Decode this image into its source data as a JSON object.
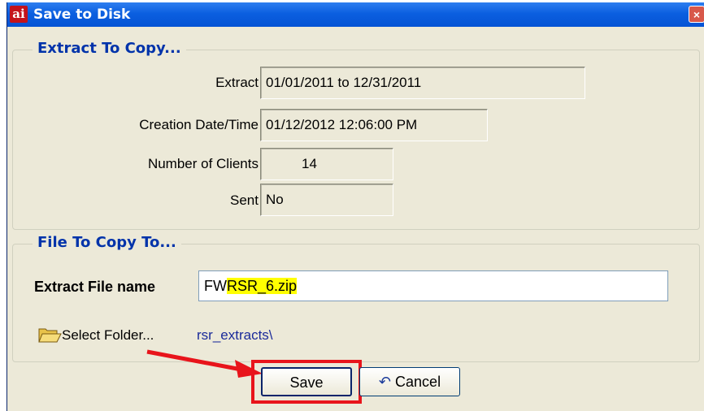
{
  "window": {
    "title": "Save to Disk",
    "app_icon": "ai",
    "close_glyph": "×"
  },
  "extract_group": {
    "legend": "Extract To Copy...",
    "fields": [
      {
        "label": "Extract",
        "value": "01/01/2011 to 12/31/2011"
      },
      {
        "label": "Creation Date/Time",
        "value": "01/12/2012 12:06:00 PM"
      },
      {
        "label": "Number of Clients",
        "value": "14"
      },
      {
        "label": "Sent",
        "value": "No"
      }
    ]
  },
  "file_group": {
    "legend": "File To Copy To...",
    "file_label": "Extract File name",
    "file_value_prefix": "FW",
    "file_value_highlight": "RSR_6.zip",
    "select_folder_label": "Select Folder...",
    "folder_path": "rsr_extracts\\",
    "icons": {
      "folder": "open-folder-icon"
    }
  },
  "buttons": {
    "save": "Save",
    "cancel": "Cancel",
    "cancel_icon": "undo-icon"
  },
  "colors": {
    "highlight": "#ffff00",
    "annotation": "#e8141b",
    "title_bar": "#0b5fe0"
  }
}
